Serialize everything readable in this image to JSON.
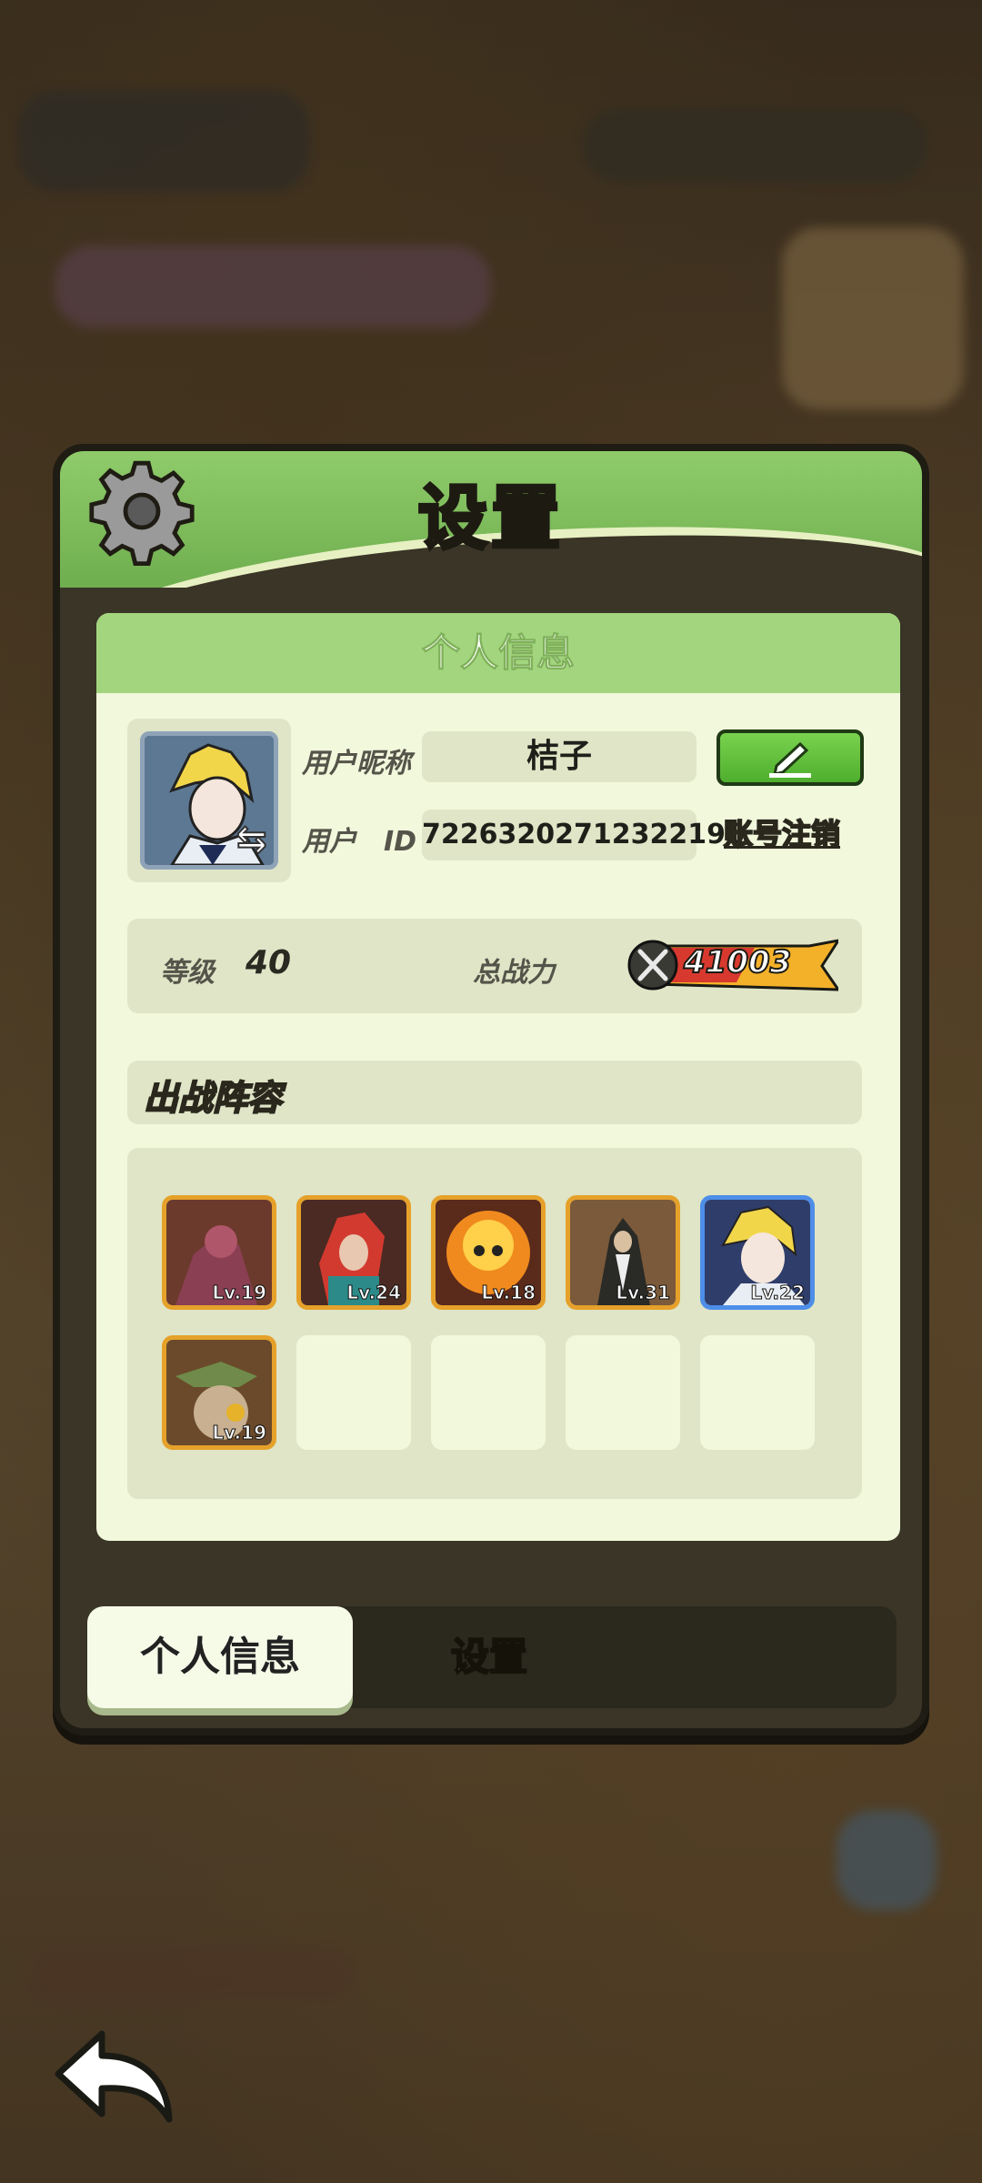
{
  "dialog": {
    "title": "设置",
    "panel_title": "个人信息"
  },
  "profile": {
    "nickname_label": "用户昵称",
    "nickname": "桔子",
    "id_label": "用户　ID",
    "user_id": "72263202712322196",
    "cancel_account": "账号注销"
  },
  "stats": {
    "level_label": "等级",
    "level": "40",
    "power_label": "总战力",
    "power": "41003"
  },
  "lineup": {
    "title": "出战阵容",
    "heroes": [
      {
        "level": "Lv.19",
        "color": "#7a3b3b"
      },
      {
        "level": "Lv.24",
        "color": "#b8362f"
      },
      {
        "level": "Lv.18",
        "color": "#d6752a"
      },
      {
        "level": "Lv.31",
        "color": "#4a4a3a"
      },
      {
        "level": "Lv.22",
        "color": "#2f3d6b"
      },
      {
        "level": "Lv.19",
        "color": "#5a6a38"
      }
    ],
    "empty_slots": 4
  },
  "tabs": {
    "active": "个人信息",
    "inactive": "设置"
  },
  "icons": {
    "gear": "gear-icon",
    "edit": "pencil-icon",
    "swap": "swap-icon",
    "power": "crossed-swords-icon",
    "back": "back-arrow-icon"
  }
}
